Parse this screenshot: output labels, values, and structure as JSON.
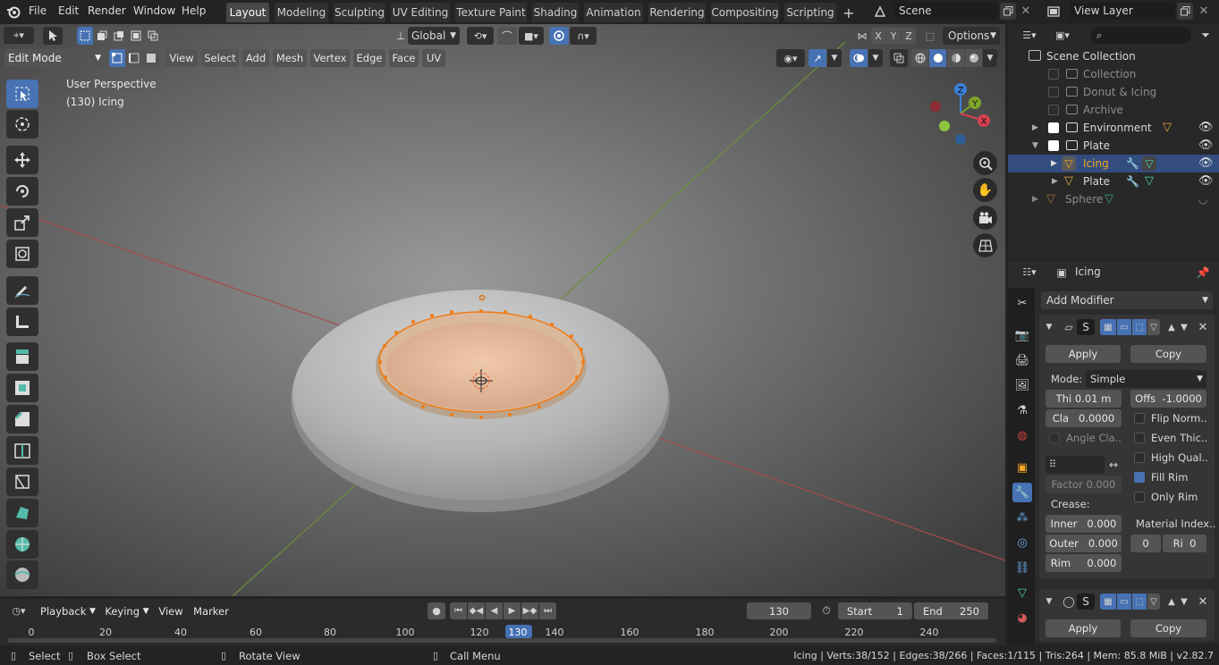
{
  "topbar": {
    "menus": [
      "File",
      "Edit",
      "Render",
      "Window",
      "Help"
    ],
    "tabs": [
      "Layout",
      "Modeling",
      "Sculpting",
      "UV Editing",
      "Texture Paint",
      "Shading",
      "Animation",
      "Rendering",
      "Compositing",
      "Scripting"
    ],
    "scene_name": "Scene",
    "view_layer": "View Layer"
  },
  "viewport_header": {
    "orientation": "Global",
    "options": "Options",
    "mode": "Edit Mode",
    "menus": [
      "View",
      "Select",
      "Add",
      "Mesh",
      "Vertex",
      "Edge",
      "Face",
      "UV"
    ],
    "axes": [
      "X",
      "Y",
      "Z"
    ]
  },
  "viewport": {
    "perspective": "User Perspective",
    "object_label": "(130) Icing",
    "gizmo": {
      "z": "Z",
      "y": "Y",
      "x": "X"
    }
  },
  "outliner": {
    "search_placeholder": "",
    "root": "Scene Collection",
    "items": [
      {
        "label": "Collection",
        "dim": true
      },
      {
        "label": "Donut & Icing",
        "dim": true
      },
      {
        "label": "Archive",
        "dim": true
      },
      {
        "label": "Environment",
        "dim": false
      },
      {
        "label": "Plate",
        "dim": false
      },
      {
        "label": "Icing",
        "dim": false
      },
      {
        "label": "Plate",
        "dim": false
      },
      {
        "label": "Sphere",
        "dim": true
      }
    ]
  },
  "properties": {
    "object_name": "Icing",
    "add_modifier": "Add Modifier",
    "modifier1": {
      "name": "S",
      "apply": "Apply",
      "copy": "Copy",
      "mode_label": "Mode:",
      "mode_value": "Simple",
      "thickness_label": "Thi",
      "thickness_value": "0.01 m",
      "offset_label": "Offs",
      "offset_value": "-1.0000",
      "clamp_label": "Cla",
      "clamp_value": "0.0000",
      "flip_normals": "Flip Norm..",
      "angle_clamp": "Angle Cla..",
      "even_thickness": "Even Thic..",
      "high_quality": "High Qual..",
      "fill_rim": "Fill Rim",
      "only_rim": "Only Rim",
      "factor_label": "Factor",
      "factor_value": "0.000",
      "crease_label": "Crease:",
      "inner_label": "Inner",
      "inner_value": "0.000",
      "outer_label": "Outer",
      "outer_value": "0.000",
      "rim_label": "Rim",
      "rim_value": "0.000",
      "material_index_label": "Material Index..",
      "material_index_value": "0",
      "material_rim_label": "Ri",
      "material_rim_value": "0"
    },
    "modifier2": {
      "name": "S",
      "apply": "Apply",
      "copy": "Copy"
    }
  },
  "timeline": {
    "menus": [
      "Playback",
      "Keying",
      "View",
      "Marker"
    ],
    "current_frame": "130",
    "start_label": "Start",
    "start_value": "1",
    "end_label": "End",
    "end_value": "250",
    "ticks": [
      "0",
      "20",
      "40",
      "60",
      "80",
      "100",
      "120",
      "130",
      "140",
      "160",
      "180",
      "200",
      "220",
      "240"
    ]
  },
  "statusbar": {
    "select": "Select",
    "box_select": "Box Select",
    "rotate_view": "Rotate View",
    "call_menu": "Call Menu",
    "stats": "Icing | Verts:38/152 | Edges:38/266 | Faces:1/115 | Tris:264 | Mem: 85.8 MiB | v2.82.7"
  },
  "colors": {
    "accent": "#4772b3",
    "selection": "#f5a623",
    "viewport_bg": "#3d3d3d"
  }
}
